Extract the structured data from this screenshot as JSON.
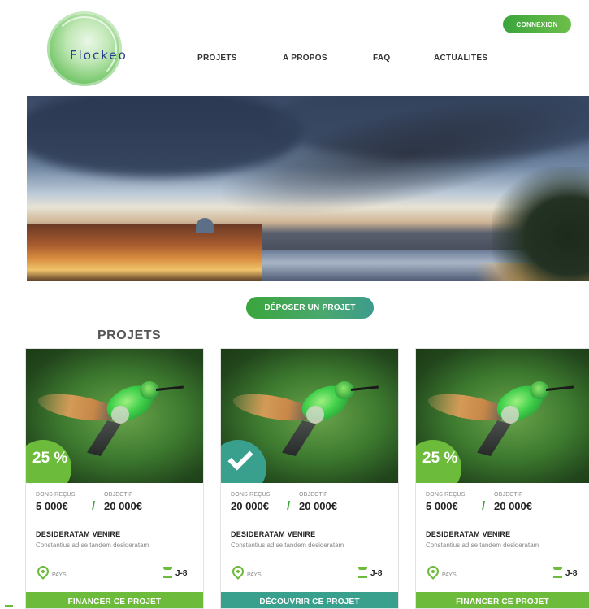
{
  "header": {
    "logo_text": "Flockeo",
    "nav": [
      "PROJETS",
      "A PROPOS",
      "FAQ",
      "ACTUALITES"
    ],
    "login_label": "CONNEXION"
  },
  "hero": {
    "deposit_label": "DÉPOSER UN PROJET"
  },
  "projects": {
    "title": "PROJETS",
    "cards": [
      {
        "badge": "25 %",
        "received_label": "DONS REÇUS",
        "received_value": "5 000€",
        "goal_label": "OBJECTIF",
        "goal_value": "20 000€",
        "title": "DESIDERATAM VENIRE",
        "description": "Constantius ad se tandem desideratam",
        "location": "PAYS",
        "days_left": "J-8",
        "action": "FINANCER CE PROJET"
      },
      {
        "badge": "",
        "received_label": "DONS REÇUS",
        "received_value": "20 000€",
        "goal_label": "OBJECTIF",
        "goal_value": "20 000€",
        "title": "DESIDERATAM VENIRE",
        "description": "Constantius ad se tandem desideratam",
        "location": "PAYS",
        "days_left": "J-8",
        "action": "DÉCOUVRIR CE PROJET"
      },
      {
        "badge": "25 %",
        "received_label": "DONS REÇUS",
        "received_value": "5 000€",
        "goal_label": "OBJECTIF",
        "goal_value": "20 000€",
        "title": "DESIDERATAM VENIRE",
        "description": "Constantius ad se tandem desideratam",
        "location": "PAYS",
        "days_left": "J-8",
        "action": "FINANCER CE PROJET"
      }
    ]
  },
  "colors": {
    "brand_green": "#6dbb3a",
    "teal": "#3aa08e",
    "nav_text": "#333333"
  }
}
